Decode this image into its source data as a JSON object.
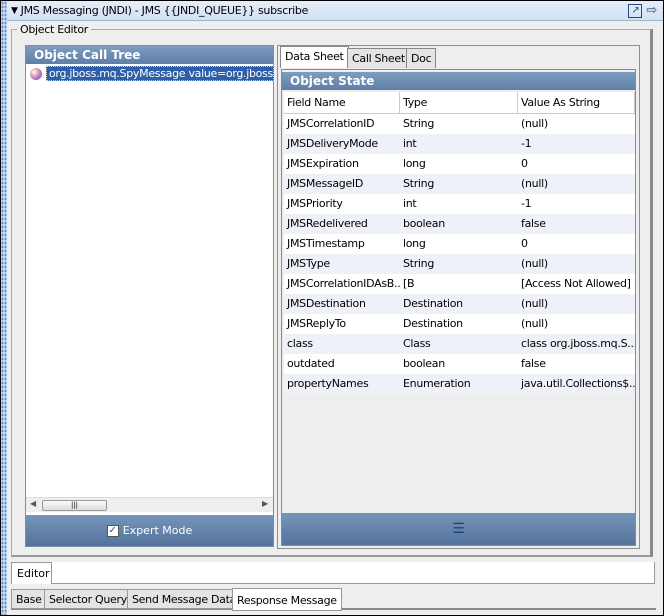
{
  "title": "JMS Messaging (JNDI) - JMS {{JNDI_QUEUE}} subscribe",
  "group_label": "Object Editor",
  "left_panel": {
    "header": "Object Call Tree",
    "tree_item": "org.jboss.mq.SpyMessage value=org.jboss.mq",
    "expert_mode_label": "Expert Mode",
    "expert_mode_checked": true
  },
  "right_panel": {
    "tabs": [
      "Data Sheet",
      "Call Sheet",
      "Doc"
    ],
    "active_tab": "Data Sheet",
    "header": "Object State",
    "columns": [
      "Field Name",
      "Type",
      "Value As String"
    ],
    "rows": [
      [
        "JMSCorrelationID",
        "String",
        "(null)"
      ],
      [
        "JMSDeliveryMode",
        "int",
        "-1"
      ],
      [
        "JMSExpiration",
        "long",
        "0"
      ],
      [
        "JMSMessageID",
        "String",
        "(null)"
      ],
      [
        "JMSPriority",
        "int",
        "-1"
      ],
      [
        "JMSRedelivered",
        "boolean",
        "false"
      ],
      [
        "JMSTimestamp",
        "long",
        "0"
      ],
      [
        "JMSType",
        "String",
        "(null)"
      ],
      [
        "JMSCorrelationIDAsB...",
        "[B",
        "[Access Not Allowed]"
      ],
      [
        "JMSDestination",
        "Destination",
        "(null)"
      ],
      [
        "JMSReplyTo",
        "Destination",
        "(null)"
      ],
      [
        "class",
        "Class",
        "class org.jboss.mq.S..."
      ],
      [
        "outdated",
        "boolean",
        "false"
      ],
      [
        "propertyNames",
        "Enumeration",
        "java.util.Collections$..."
      ]
    ]
  },
  "editor_tab": "Editor",
  "bottom_tabs": [
    "Base",
    "Selector Query",
    "Send Message Data",
    "Response Message"
  ],
  "active_bottom_tab": "Response Message"
}
